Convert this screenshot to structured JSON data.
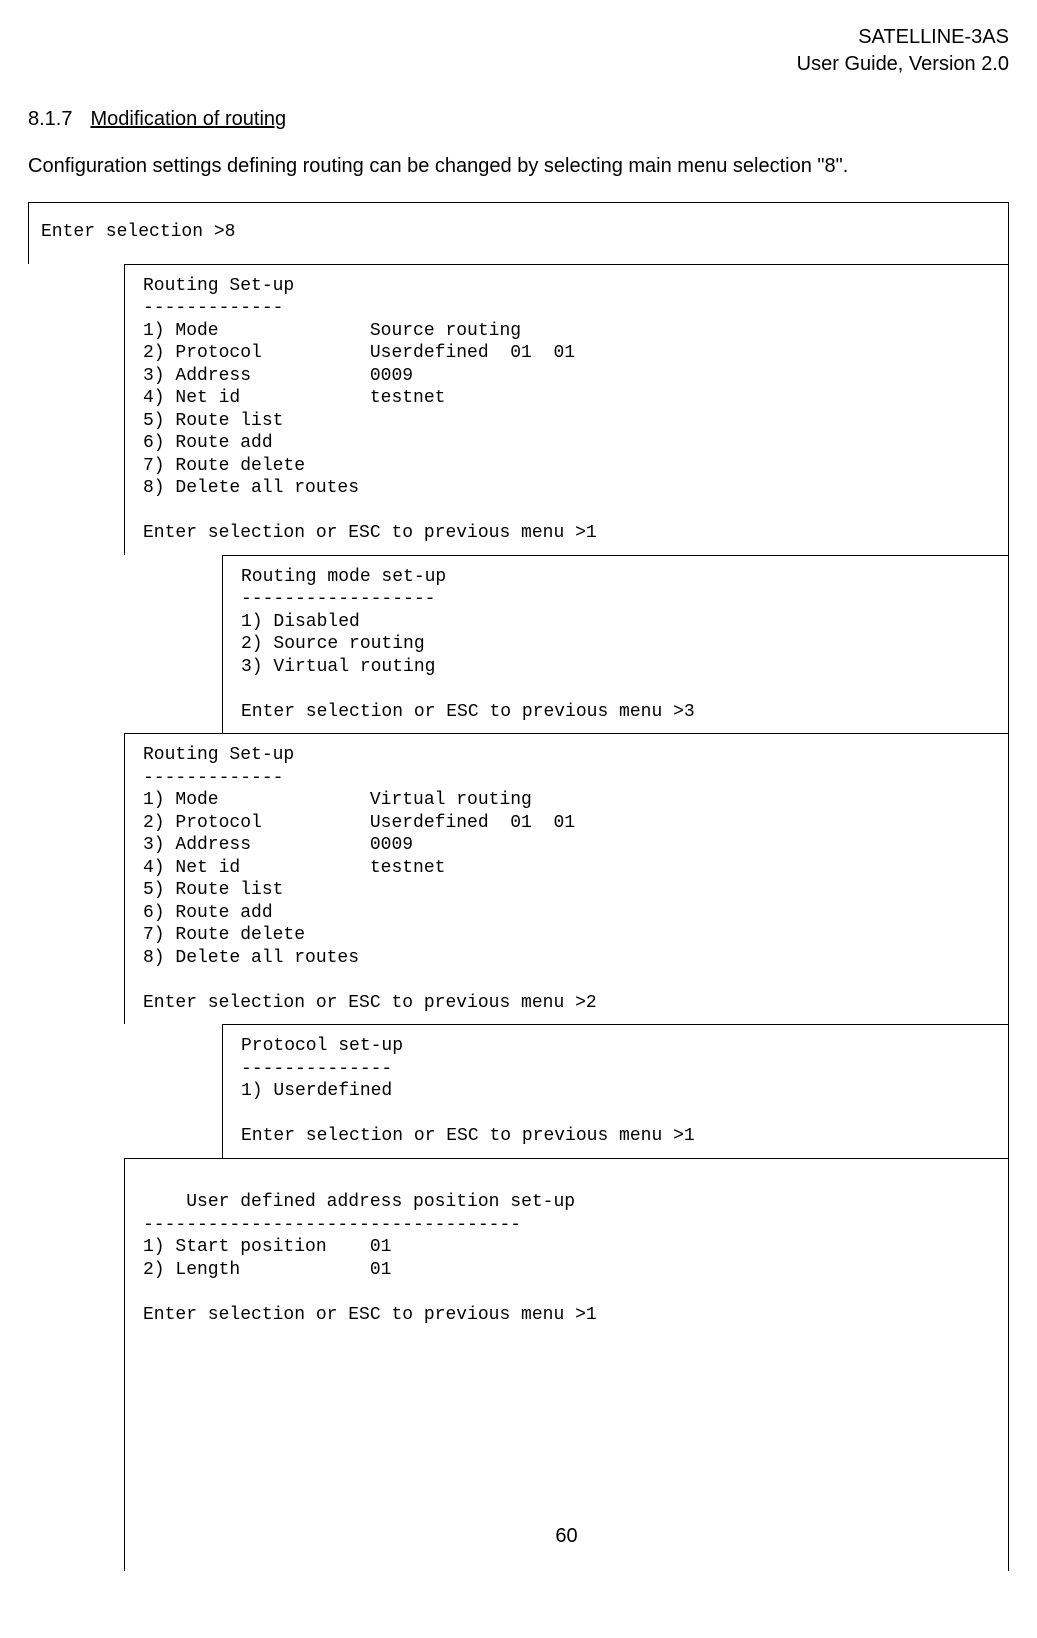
{
  "header": {
    "line1": "SATELLINE-3AS",
    "line2": "User Guide, Version 2.0"
  },
  "section": {
    "num": "8.1.7",
    "title": "Modification of routing"
  },
  "intro": "Configuration settings defining routing can be changed by selecting main menu selection \"8\".",
  "box1": "Enter selection >8",
  "box2": "Routing Set-up\n-------------\n1) Mode              Source routing\n2) Protocol          Userdefined  01  01\n3) Address           0009\n4) Net id            testnet\n5) Route list\n6) Route add\n7) Route delete\n8) Delete all routes\n\nEnter selection or ESC to previous menu >1",
  "box3": "Routing mode set-up\n------------------\n1) Disabled\n2) Source routing\n3) Virtual routing\n\nEnter selection or ESC to previous menu >3",
  "box4": "Routing Set-up\n-------------\n1) Mode              Virtual routing\n2) Protocol          Userdefined  01  01\n3) Address           0009\n4) Net id            testnet\n5) Route list\n6) Route add\n7) Route delete\n8) Delete all routes\n\nEnter selection or ESC to previous menu >2",
  "box5": "Protocol set-up\n--------------\n1) Userdefined\n\nEnter selection or ESC to previous menu >1",
  "box6": "User defined address position set-up\n-----------------------------------\n1) Start position    01\n2) Length            01\n\nEnter selection or ESC to previous menu >1",
  "page": "60"
}
